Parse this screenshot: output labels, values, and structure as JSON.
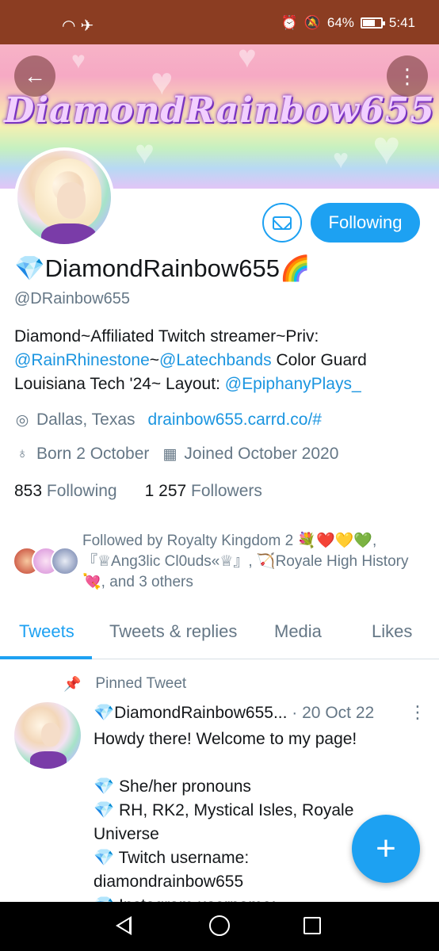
{
  "status_bar": {
    "left_icons": "wifi-icon airplane-icon",
    "battery": "64%",
    "time": "5:41"
  },
  "banner": {
    "title": "DiamondRainbow655"
  },
  "profile": {
    "name": "💎DiamondRainbow655🌈",
    "handle": "@DRainbow655",
    "follow_button": "Following",
    "bio_part1": "Diamond~Affiliated Twitch streamer~Priv: ",
    "bio_link1": "@RainRhinestone",
    "bio_sep": "~",
    "bio_link2": "@Latechbands",
    "bio_part2": " Color Guard Louisiana Tech '24~ Layout: ",
    "bio_link3": "@EpiphanyPlays_",
    "location": "Dallas, Texas",
    "website": "drainbow655.carrd.co/#",
    "born": "Born 2 October",
    "joined": "Joined October 2020",
    "following_count": "853",
    "following_label": "Following",
    "followers_count": "1 257",
    "followers_label": "Followers",
    "followed_by": "Followed by Royalty Kingdom 2 💐❤️💛💚, 『♕Ang3lic Cl0uds«♕』, 🏹Royale High History💘, and 3 others"
  },
  "tabs": [
    {
      "label": "Tweets",
      "active": true
    },
    {
      "label": "Tweets & replies",
      "active": false
    },
    {
      "label": "Media",
      "active": false
    },
    {
      "label": "Likes",
      "active": false
    }
  ],
  "pinned_tweet": {
    "pinned_label": "Pinned Tweet",
    "author": "💎DiamondRainbow655...",
    "date": "20 Oct 22",
    "body": "Howdy there! Welcome to my page!\n\n💎 She/her pronouns\n💎 RH, RK2, Mystical Isles, Royale Universe\n💎 Twitch username: diamondrainbow655\n💎 Instagram username:"
  },
  "fab": {
    "label": "+"
  },
  "colors": {
    "accent": "#1da1f2",
    "link": "#1b95e0",
    "status_bar": "#8b3d22",
    "secondary_text": "#657786"
  }
}
